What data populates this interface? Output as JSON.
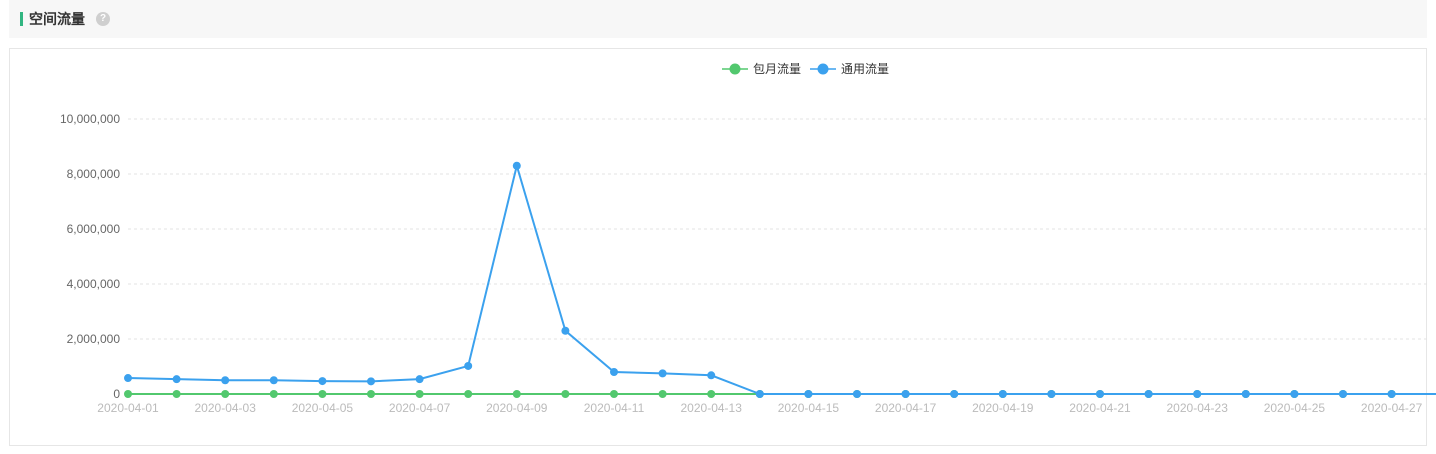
{
  "header": {
    "title": "空间流量",
    "help_icon": "question-icon",
    "help_glyph": "?",
    "accent_color": "#31b581"
  },
  "chart_data": {
    "type": "line",
    "x": [
      "2020-04-01",
      "2020-04-02",
      "2020-04-03",
      "2020-04-04",
      "2020-04-05",
      "2020-04-06",
      "2020-04-07",
      "2020-04-08",
      "2020-04-09",
      "2020-04-10",
      "2020-04-11",
      "2020-04-12",
      "2020-04-13",
      "2020-04-14",
      "2020-04-15",
      "2020-04-16",
      "2020-04-17",
      "2020-04-18",
      "2020-04-19",
      "2020-04-20",
      "2020-04-21",
      "2020-04-22",
      "2020-04-23",
      "2020-04-24",
      "2020-04-25",
      "2020-04-26",
      "2020-04-27"
    ],
    "x_tick_labels": [
      "2020-04-01",
      "2020-04-03",
      "2020-04-05",
      "2020-04-07",
      "2020-04-09",
      "2020-04-11",
      "2020-04-13",
      "2020-04-15",
      "2020-04-17",
      "2020-04-19",
      "2020-04-21",
      "2020-04-23",
      "2020-04-25",
      "2020-04-27"
    ],
    "series": [
      {
        "name": "包月流量",
        "color": "#52c86e",
        "values": [
          0,
          0,
          0,
          0,
          0,
          0,
          0,
          0,
          0,
          0,
          0,
          0,
          0,
          0,
          0,
          0,
          0,
          0,
          0,
          0,
          0,
          0,
          0,
          0,
          0,
          0,
          0
        ]
      },
      {
        "name": "通用流量",
        "color": "#3ba1ee",
        "values": [
          580000,
          540000,
          500000,
          500000,
          470000,
          460000,
          540000,
          1020000,
          8300000,
          2300000,
          800000,
          750000,
          680000,
          0,
          0,
          0,
          0,
          0,
          0,
          0,
          0,
          0,
          0,
          0,
          0,
          0,
          0
        ]
      }
    ],
    "y_ticks": [
      "0",
      "2,000,000",
      "4,000,000",
      "6,000,000",
      "8,000,000",
      "10,000,000"
    ],
    "ylim": [
      0,
      10000000
    ],
    "grid": true,
    "legend_position": "top-center"
  }
}
